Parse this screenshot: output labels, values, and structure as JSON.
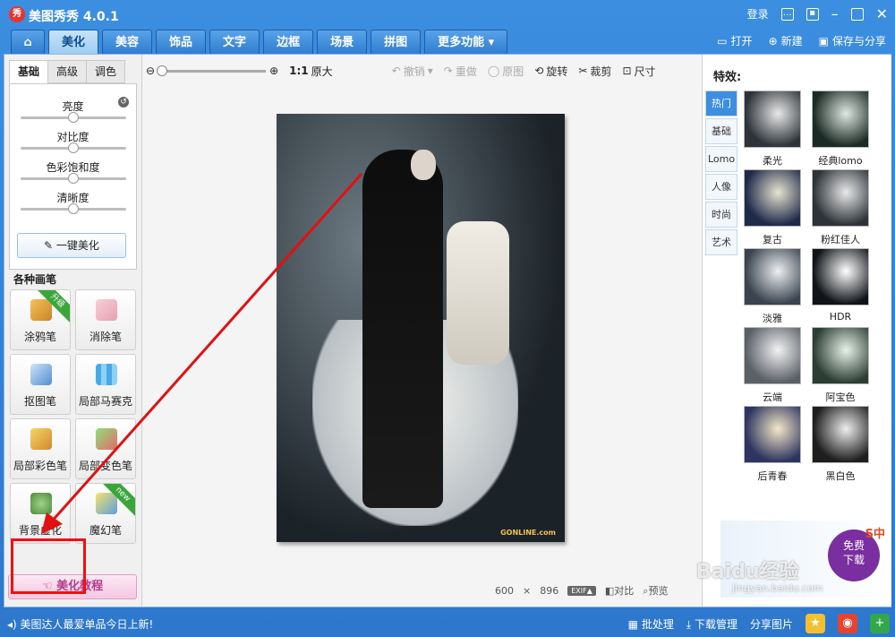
{
  "titlebar": {
    "app_title": "美图秀秀 4.0.1",
    "logo_text": "秀",
    "login": "登录"
  },
  "tabs": [
    {
      "label": "美化",
      "active": true
    },
    {
      "label": "美容"
    },
    {
      "label": "饰品"
    },
    {
      "label": "文字"
    },
    {
      "label": "边框"
    },
    {
      "label": "场景"
    },
    {
      "label": "拼图"
    },
    {
      "label": "更多功能 ▾"
    }
  ],
  "toolbar": {
    "open": "打开",
    "new": "新建",
    "save_share": "保存与分享"
  },
  "left": {
    "subtabs": [
      "基础",
      "高级",
      "调色"
    ],
    "sliders": [
      {
        "label": "亮度",
        "level": 0.5
      },
      {
        "label": "对比度",
        "level": 0.5
      },
      {
        "label": "色彩饱和度",
        "level": 0.5
      },
      {
        "label": "清晰度",
        "level": 0.5
      }
    ],
    "one_key": "一键美化",
    "section": "各种画笔",
    "brushes": [
      {
        "label": "涂鸦笔",
        "badge": "升级"
      },
      {
        "label": "消除笔",
        "badge": ""
      },
      {
        "label": "抠图笔",
        "badge": ""
      },
      {
        "label": "局部马赛克",
        "badge": ""
      },
      {
        "label": "局部彩色笔",
        "badge": ""
      },
      {
        "label": "局部变色笔",
        "badge": ""
      },
      {
        "label": "背景虚化",
        "badge": ""
      },
      {
        "label": "魔幻笔",
        "badge": "new"
      }
    ],
    "tutorial": "美化教程"
  },
  "canvasbar": {
    "ratio": "1:1",
    "original_size": "原大",
    "undo": "撤销",
    "redo": "重做",
    "original": "原图",
    "rotate": "旋转",
    "crop": "裁剪",
    "resize": "尺寸"
  },
  "image": {
    "width": "600",
    "times": "×",
    "height": "896",
    "exif": "EXIF▲",
    "compare": "对比",
    "preview": "预览",
    "watermark": "GONLINE.com"
  },
  "effects": {
    "title": "特效:",
    "tabs": [
      "热门",
      "基础",
      "Lomo",
      "人像",
      "时尚",
      "艺术"
    ],
    "items": [
      "柔光",
      "经典lomo",
      "复古",
      "粉红佳人",
      "淡雅",
      "HDR",
      "云端",
      "阿宝色",
      "后青春",
      "黑白色"
    ],
    "ad": {
      "line1": "免费",
      "line2": "下载",
      "brand": "S中"
    }
  },
  "statusbar": {
    "message": "美图达人最爱单品今日上新!",
    "batch": "批处理",
    "download": "下载管理",
    "share": "分享图片"
  },
  "watermark": {
    "text": "Baidu经验",
    "url": "jingyan.baidu.com"
  },
  "colors": {
    "accent": "#2d78cc",
    "highlight": "#e11111"
  }
}
